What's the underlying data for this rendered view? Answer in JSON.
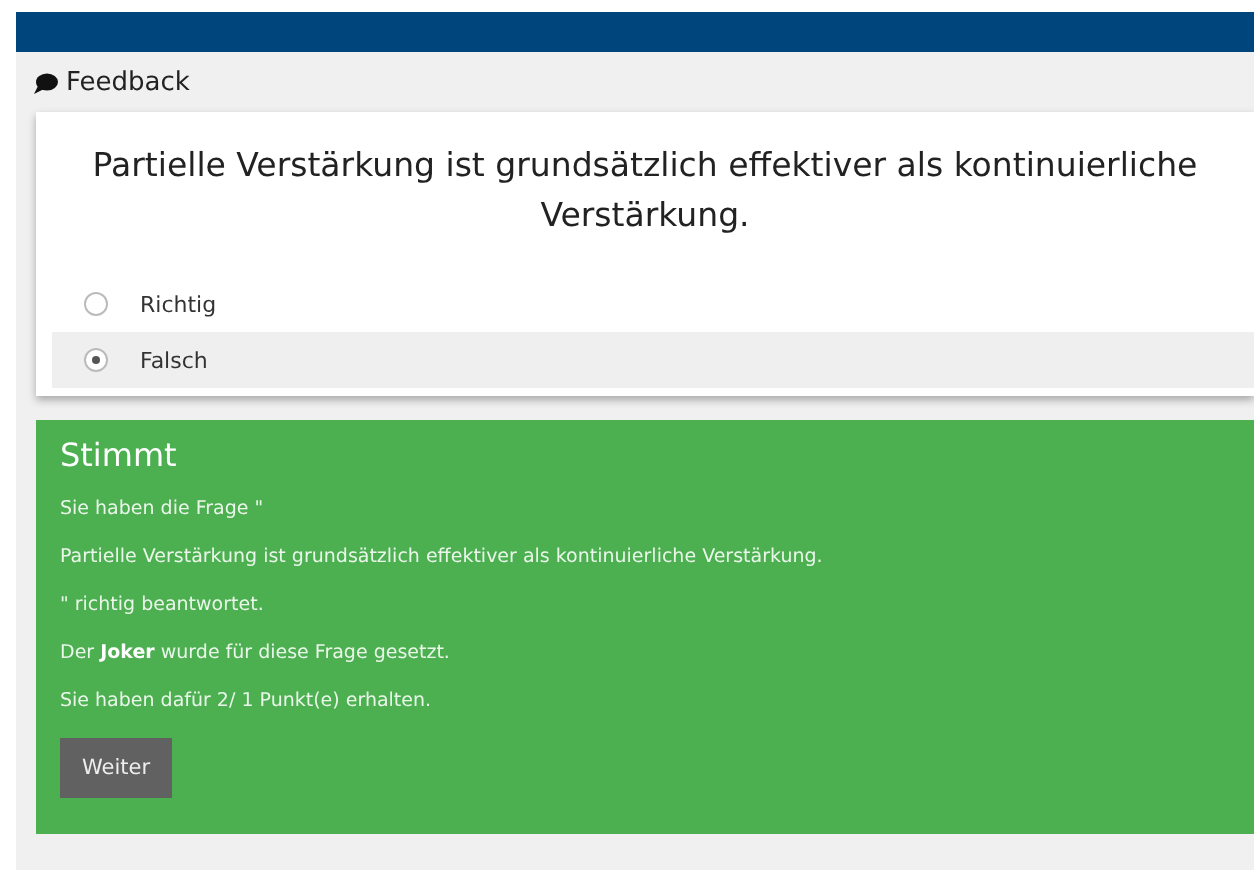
{
  "panel": {
    "title": "Feedback"
  },
  "question": {
    "text": "Partielle Verstärkung ist grundsätzlich effektiver als kontinuierliche Verstärkung.",
    "options": [
      {
        "label": "Richtig",
        "selected": false
      },
      {
        "label": "Falsch",
        "selected": true
      }
    ]
  },
  "result": {
    "title": "Stimmt",
    "lines": [
      "Sie haben die Frage \"",
      "Partielle Verstärkung ist grundsätzlich effektiver als kontinuierliche Verstärkung.",
      "\" richtig beantwortet.",
      "Der **Joker** wurde für diese Frage gesetzt.",
      "Sie haben dafür 2/ 1 Punkt(e) erhalten."
    ],
    "button": "Weiter"
  }
}
